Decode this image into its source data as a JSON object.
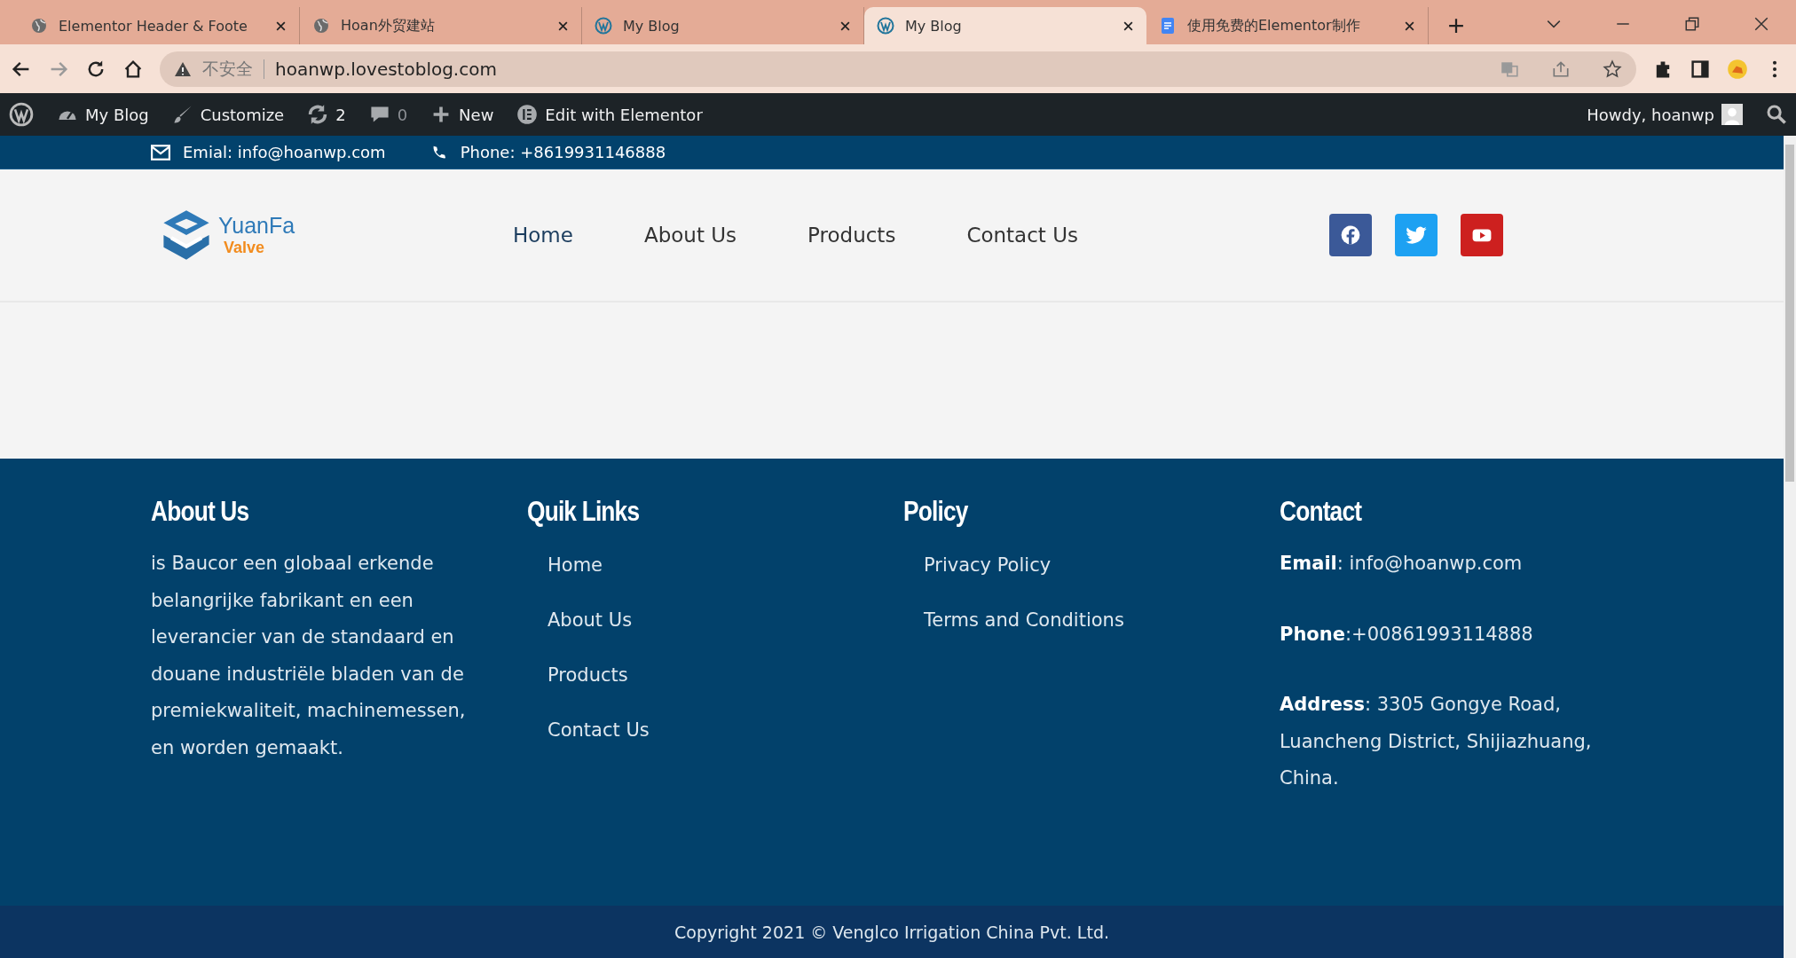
{
  "browser": {
    "tabs": [
      {
        "title": "Elementor Header & Foote",
        "selected": false
      },
      {
        "title": "Hoan外贸建站",
        "selected": false
      },
      {
        "title": "My Blog",
        "selected": false
      },
      {
        "title": "My Blog",
        "selected": true
      },
      {
        "title": "使用免费的Elementor制作",
        "selected": false
      }
    ],
    "security": "不安全",
    "url": "hoanwp.lovestoblog.com"
  },
  "admin_bar": {
    "items": [
      {
        "label": "My Blog"
      },
      {
        "label": "Customize"
      },
      {
        "label": "2"
      },
      {
        "label": "0"
      },
      {
        "label": "New"
      },
      {
        "label": "Edit with Elementor"
      }
    ],
    "greeting": "Howdy, hoanwp"
  },
  "topbar": {
    "email": "Emial: info@hoanwp.com",
    "phone": "Phone: +8619931146888"
  },
  "header": {
    "logo": {
      "name": "YuanFa",
      "sub": "Valve"
    },
    "nav": [
      "Home",
      "About Us",
      "Products",
      "Contact Us"
    ],
    "social": [
      {
        "kind": "facebook",
        "color": "#3b5998"
      },
      {
        "kind": "twitter",
        "color": "#1da1f2"
      },
      {
        "kind": "youtube",
        "color": "#cd201f"
      }
    ]
  },
  "footer": {
    "columns": [
      {
        "kind": "text",
        "title": "About Us",
        "text": "is Baucor een globaal erkende belangrijke fabrikant en een leverancier van de standaard en douane industriële bladen van de premiekwaliteit, machinemessen, en  worden gemaakt."
      },
      {
        "kind": "links",
        "title": "Quik Links",
        "links": [
          "Home",
          "About Us",
          "Products",
          "Contact Us"
        ]
      },
      {
        "kind": "links",
        "title": "Policy",
        "links": [
          "Privacy Policy",
          "Terms and Conditions"
        ]
      },
      {
        "kind": "contact",
        "title": "Contact",
        "lines": [
          "**Email**: info@hoanwp.com",
          "**Phone**:+00861993114888",
          "**Address**:  3305 Gongye Road, Luancheng District, Shijiazhuang, China."
        ]
      }
    ],
    "copyright": "Copyright 2021 © Venglco Irrigation China Pvt. Ltd."
  }
}
